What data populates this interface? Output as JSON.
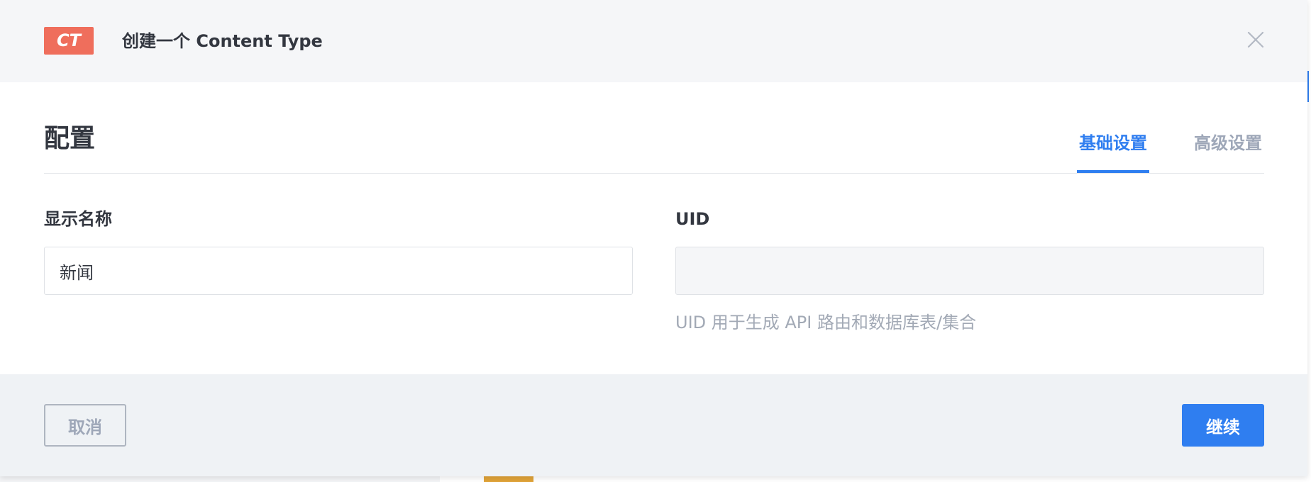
{
  "modal": {
    "badge": "CT",
    "title": "创建一个 Content Type",
    "section_title": "配置",
    "tabs": [
      {
        "label": "基础设置",
        "active": true
      },
      {
        "label": "高级设置",
        "active": false
      }
    ],
    "fields": {
      "display_name": {
        "label": "显示名称",
        "value": "新闻"
      },
      "uid": {
        "label": "UID",
        "value": "",
        "hint": "UID 用于生成 API 路由和数据库表/集合"
      }
    },
    "footer": {
      "cancel_label": "取消",
      "continue_label": "继续"
    }
  },
  "icons": {
    "close": "close-icon"
  },
  "colors": {
    "accent": "#2f7ef0",
    "badge": "#ef6e5c",
    "text": "#333740",
    "muted": "#9ea7b8"
  }
}
